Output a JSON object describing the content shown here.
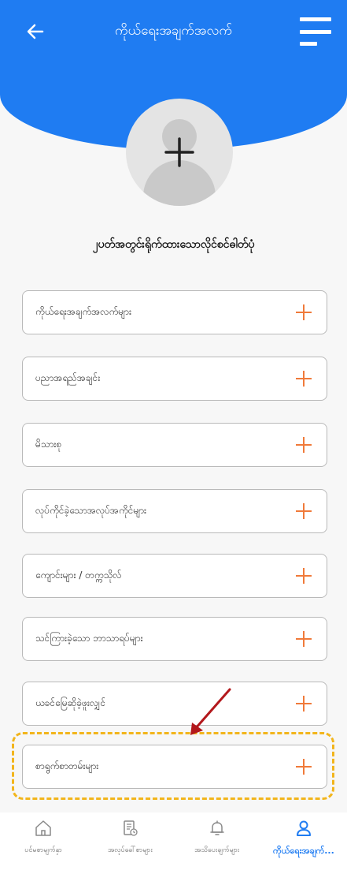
{
  "header": {
    "title": "ကိုယ်ရေးအချက်အလက်",
    "back_icon": "arrow-left-icon",
    "menu_icon": "hamburger-menu-icon"
  },
  "profile": {
    "photo_label": "၂ပတ်အတွင်းရိုက်ထားသောလိုင်စင်ဓါတ်ပုံ"
  },
  "sections": [
    {
      "label": "ကိုယ်ရေးအချက်အလက်များ"
    },
    {
      "label": "ပညာအရည်အချင်း"
    },
    {
      "label": "မိသားစု"
    },
    {
      "label": "လုပ်ကိုင်ခဲ့သောအလုပ်အကိုင်များ"
    },
    {
      "label": "ကျောင်းများ / တက္ကသိုလ်"
    },
    {
      "label": "သင်ကြားခဲ့သော ဘာသာရပ်များ"
    },
    {
      "label": "ယခင်မြေဆိုခဲ့ဖူးလျှင်"
    },
    {
      "label": "စာရွက်စာတမ်းများ"
    }
  ],
  "bottom_nav": [
    {
      "label": "ပင်မစာမျက်နှာ",
      "icon": "home-icon"
    },
    {
      "label": "အလုပ်ခေါ်စာများ",
      "icon": "document-icon"
    },
    {
      "label": "အသိပေးချက်များ",
      "icon": "bell-icon"
    },
    {
      "label": "ကိုယ်ရေးအချက်...",
      "icon": "user-icon",
      "active": true
    }
  ],
  "colors": {
    "primary": "#1f7cf2",
    "plus_accent": "#f07a3a",
    "highlight": "#f2b51c",
    "arrow": "#b3181c"
  }
}
